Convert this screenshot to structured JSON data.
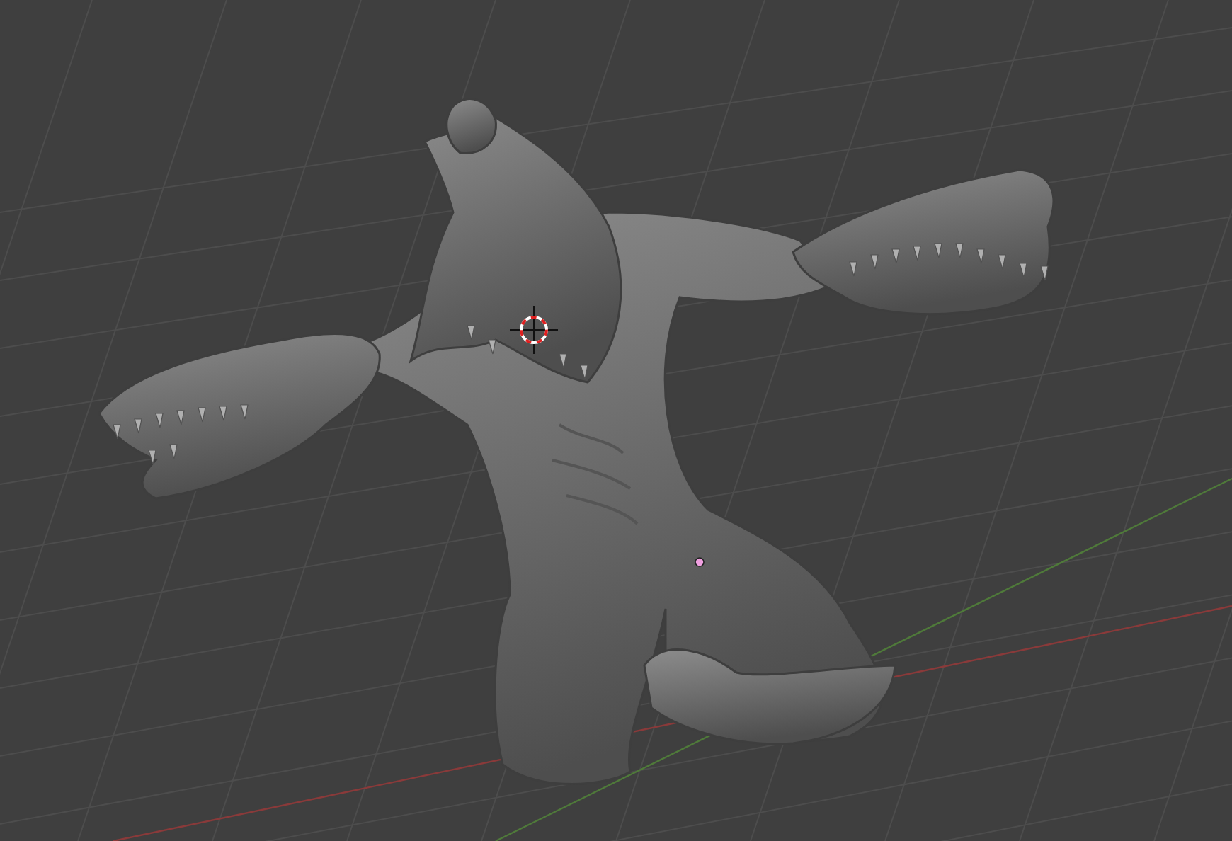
{
  "viewport": {
    "grid_floor": true,
    "cursor_3d": true,
    "origin_point": true
  }
}
